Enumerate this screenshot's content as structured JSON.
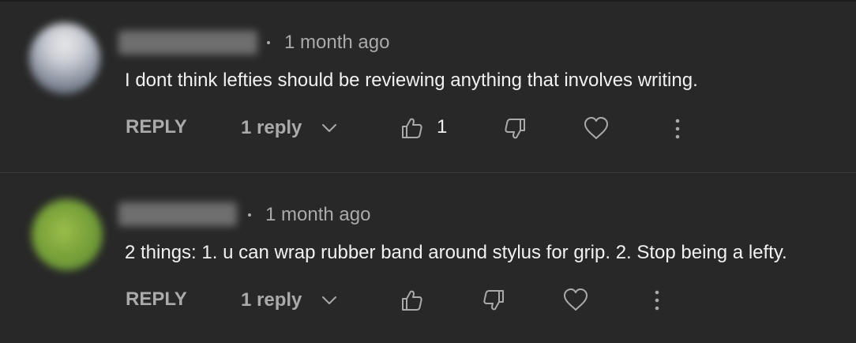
{
  "comments": [
    {
      "timestamp": "1 month ago",
      "text": "I dont think lefties should be reviewing anything that involves writing.",
      "reply_label": "REPLY",
      "replies_label": "1 reply",
      "like_count": "1"
    },
    {
      "timestamp": "1 month ago",
      "text": "2 things: 1. u can wrap rubber band around stylus for grip. 2. Stop being a lefty.",
      "reply_label": "REPLY",
      "replies_label": "1 reply",
      "like_count": ""
    }
  ],
  "icons": {
    "expand": "chevron-down-icon",
    "like": "thumbs-up-icon",
    "dislike": "thumbs-down-icon",
    "heart": "heart-icon",
    "menu": "more-vert-icon"
  },
  "colors": {
    "background": "#282828",
    "primary_text": "#f1f1f1",
    "secondary_text": "#aaaaaa",
    "divider": "#3a3a3a"
  }
}
